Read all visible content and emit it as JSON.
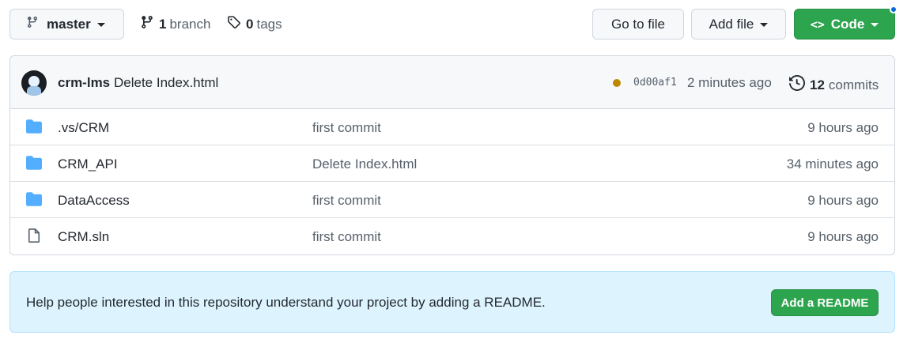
{
  "toolbar": {
    "branch_name": "master",
    "branch_count": "1",
    "branch_label": "branch",
    "tag_count": "0",
    "tag_label": "tags",
    "goto_label": "Go to file",
    "addfile_label": "Add file",
    "code_label": "Code",
    "code_glyph": "<>"
  },
  "latest_commit": {
    "author": "crm-lms",
    "message": "Delete Index.html",
    "sha": "0d00af1",
    "age": "2 minutes ago",
    "commit_count": "12",
    "commits_label": "commits",
    "status_color": "#bf8700"
  },
  "files": [
    {
      "type": "folder",
      "name": ".vs/CRM",
      "message": "first commit",
      "age": "9 hours ago"
    },
    {
      "type": "folder",
      "name": "CRM_API",
      "message": "Delete Index.html",
      "age": "34 minutes ago"
    },
    {
      "type": "folder",
      "name": "DataAccess",
      "message": "first commit",
      "age": "9 hours ago"
    },
    {
      "type": "file",
      "name": "CRM.sln",
      "message": "first commit",
      "age": "9 hours ago"
    }
  ],
  "readme": {
    "text": "Help people interested in this repository understand your project by adding a README.",
    "button_label": "Add a README"
  },
  "colors": {
    "primary_green": "#2da44e",
    "folder_blue": "#54aeff",
    "banner_bg": "#ddf4ff",
    "notify_blue": "#0969da"
  }
}
